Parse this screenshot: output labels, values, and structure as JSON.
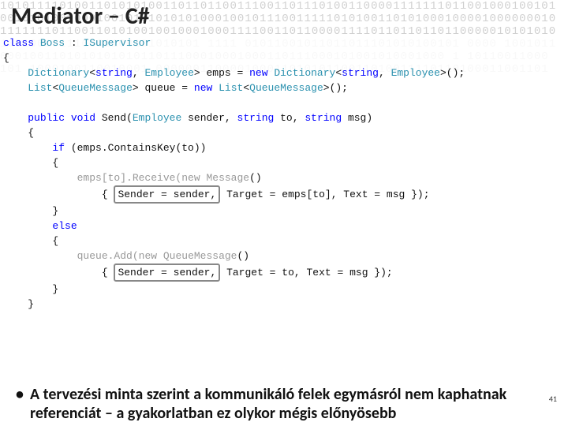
{
  "title": "Mediator – C#",
  "code": {
    "l1_a": "class",
    "l1_b": " ",
    "l1_c": "Boss",
    "l1_d": " : ",
    "l1_e": "ISupervisor",
    "l2": "{",
    "l3_a": "    ",
    "l3_b": "Dictionary",
    "l3_c": "<",
    "l3_d": "string",
    "l3_e": ", ",
    "l3_f": "Employee",
    "l3_g": "> emps = ",
    "l3_h": "new",
    "l3_i": " ",
    "l3_j": "Dictionary",
    "l3_k": "<",
    "l3_l": "string",
    "l3_m": ", ",
    "l3_n": "Employee",
    "l3_o": ">();",
    "l4_a": "    ",
    "l4_b": "List",
    "l4_c": "<",
    "l4_d": "QueueMessage",
    "l4_e": "> queue = ",
    "l4_f": "new",
    "l4_g": " ",
    "l4_h": "List",
    "l4_i": "<",
    "l4_j": "QueueMessage",
    "l4_k": ">();",
    "l5": "",
    "l6_a": "    ",
    "l6_b": "public",
    "l6_c": " ",
    "l6_d": "void",
    "l6_e": " Send(",
    "l6_f": "Employee",
    "l6_g": " sender, ",
    "l6_h": "string",
    "l6_i": " to, ",
    "l6_j": "string",
    "l6_k": " msg)",
    "l7": "    {",
    "l8_a": "        ",
    "l8_b": "if",
    "l8_c": " (emps.ContainsKey(to))",
    "l9": "        {",
    "l10_a": "            emps[to].Receive(",
    "l10_b": "new",
    "l10_c": " ",
    "l10_d": "Message",
    "l10_e": "()",
    "l11_a": "                { ",
    "l11_box": "Sender = sender,",
    "l11_c": " Target = emps[to], Text = msg });",
    "l12": "        }",
    "l13_a": "        ",
    "l13_b": "else",
    "l14": "        {",
    "l15_a": "            queue.Add(",
    "l15_b": "new",
    "l15_c": " ",
    "l15_d": "QueueMessage",
    "l15_e": "()",
    "l16_a": "                { ",
    "l16_box": "Sender = sender,",
    "l16_c": " Target = to, Text = msg });",
    "l17": "        }",
    "l18": "    }"
  },
  "bullet": "A tervezési minta szerint a kommunikáló felek egymásról nem kaphatnak referenciát – a gyakorlatban ez olykor mégis előnyösebb",
  "page_number": "41",
  "bg_rows": [
    "101011110100110101010011011011001110011011101001100001111111011001000100101",
    "001010100100010010101010101000100101110011111010100110101000100001000000010",
    "111111101100110101001001000100011110011011000011110110110110110000010101010",
    "                                                                           ",
    "                                                                           ",
    "                                                                           ",
    "                                                                           ",
    "                                                                           ",
    "                                                                           ",
    "                                                                           ",
    "                                                                           ",
    "                                                                           ",
    "                                                                           ",
    "                                                                           ",
    "                                                                           ",
    "                                                                           ",
    "                                                                           ",
    "                                                                           ",
    "                                                                           ",
    "                                                                           ",
    "                                                                           ",
    "                                                                           ",
    "                                                                           ",
    "                                                                           ",
    "                                                                           ",
    "                                                                           ",
    "                                                                           ",
    "100100101110001100101010101 1111 01011001011011011101010100101 0000 1001011",
    "000100110101010101011011100010001000110111000101001010001000 1 10110011000 ",
    "101 1000100110010001 00000011000010001101010110011010011110110100011001101 "
  ]
}
